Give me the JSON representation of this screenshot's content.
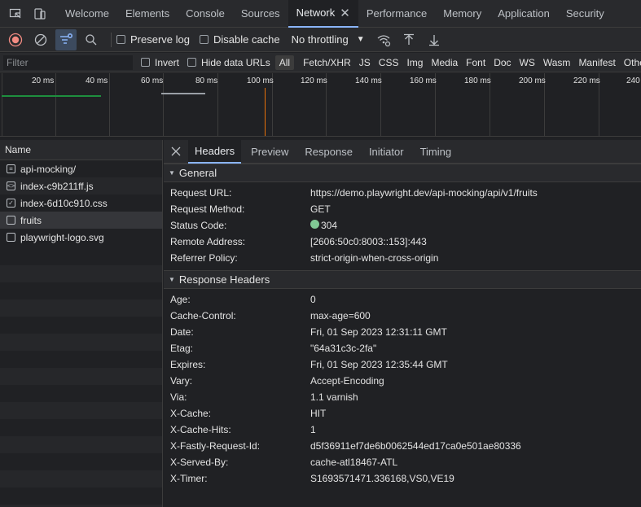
{
  "tabs": [
    {
      "label": "Welcome"
    },
    {
      "label": "Elements"
    },
    {
      "label": "Console"
    },
    {
      "label": "Sources"
    },
    {
      "label": "Network"
    },
    {
      "label": "Performance"
    },
    {
      "label": "Memory"
    },
    {
      "label": "Application"
    },
    {
      "label": "Security"
    }
  ],
  "toolbar": {
    "preserve_log": "Preserve log",
    "disable_cache": "Disable cache",
    "throttling": "No throttling"
  },
  "filter": {
    "placeholder": "Filter",
    "invert": "Invert",
    "hide_data_urls": "Hide data URLs",
    "types": [
      "All",
      "Fetch/XHR",
      "JS",
      "CSS",
      "Img",
      "Media",
      "Font",
      "Doc",
      "WS",
      "Wasm",
      "Manifest",
      "Other"
    ]
  },
  "timeline": {
    "ticks": [
      "20 ms",
      "40 ms",
      "60 ms",
      "80 ms",
      "100 ms",
      "120 ms",
      "140 ms",
      "160 ms",
      "180 ms",
      "200 ms",
      "220 ms",
      "240"
    ]
  },
  "list": {
    "header": "Name",
    "items": [
      {
        "name": "api-mocking/",
        "icon": "document-icon"
      },
      {
        "name": "index-c9b211ff.js",
        "icon": "script-icon"
      },
      {
        "name": "index-6d10c910.css",
        "icon": "stylesheet-icon"
      },
      {
        "name": "fruits",
        "icon": "fetch-icon"
      },
      {
        "name": "playwright-logo.svg",
        "icon": "image-icon"
      }
    ]
  },
  "details": {
    "tabs": [
      "Headers",
      "Preview",
      "Response",
      "Initiator",
      "Timing"
    ],
    "general": {
      "title": "General",
      "rows": [
        {
          "k": "Request URL:",
          "v": "https://demo.playwright.dev/api-mocking/api/v1/fruits"
        },
        {
          "k": "Request Method:",
          "v": "GET"
        },
        {
          "k": "Status Code:",
          "v": "304"
        },
        {
          "k": "Remote Address:",
          "v": "[2606:50c0:8003::153]:443"
        },
        {
          "k": "Referrer Policy:",
          "v": "strict-origin-when-cross-origin"
        }
      ]
    },
    "response_headers": {
      "title": "Response Headers",
      "rows": [
        {
          "k": "Age:",
          "v": "0"
        },
        {
          "k": "Cache-Control:",
          "v": "max-age=600"
        },
        {
          "k": "Date:",
          "v": "Fri, 01 Sep 2023 12:31:11 GMT"
        },
        {
          "k": "Etag:",
          "v": "\"64a31c3c-2fa\""
        },
        {
          "k": "Expires:",
          "v": "Fri, 01 Sep 2023 12:35:44 GMT"
        },
        {
          "k": "Vary:",
          "v": "Accept-Encoding"
        },
        {
          "k": "Via:",
          "v": "1.1 varnish"
        },
        {
          "k": "X-Cache:",
          "v": "HIT"
        },
        {
          "k": "X-Cache-Hits:",
          "v": "1"
        },
        {
          "k": "X-Fastly-Request-Id:",
          "v": "d5f36911ef7de6b0062544ed17ca0e501ae80336"
        },
        {
          "k": "X-Served-By:",
          "v": "cache-atl18467-ATL"
        },
        {
          "k": "X-Timer:",
          "v": "S1693571471.336168,VS0,VE19"
        }
      ]
    }
  },
  "colors": {
    "accent": "#8ab4f8",
    "record": "#f28b82",
    "status_ok": "#81c995",
    "timeline_marker": "#e8710a"
  }
}
